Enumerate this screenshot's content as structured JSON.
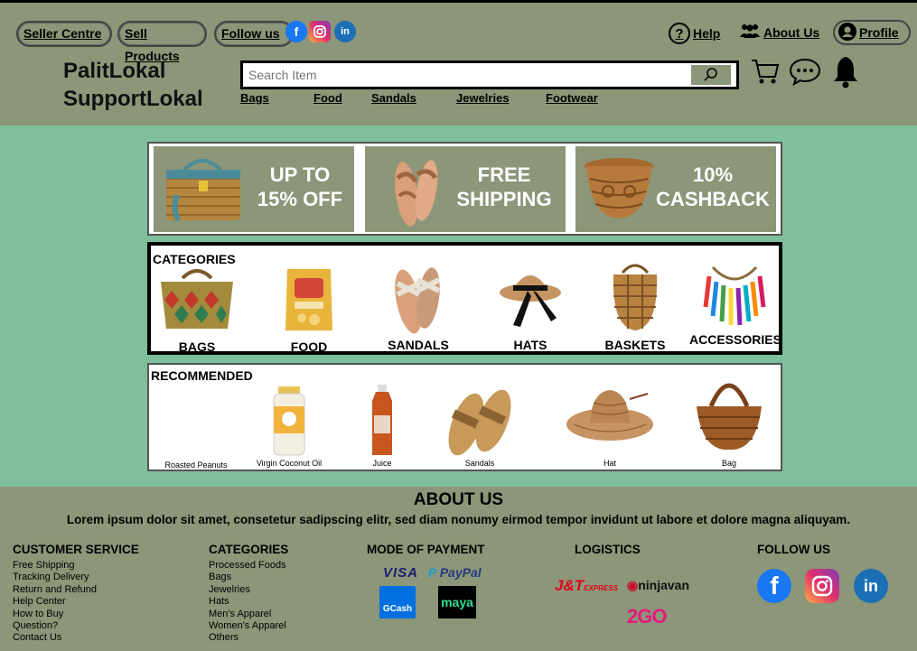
{
  "header": {
    "seller_centre": "Seller Centre",
    "sell_products": "Sell Products",
    "follow_us": "Follow us",
    "help": "Help",
    "about_us": "About Us",
    "profile": "Profile",
    "brand_line1": "PalitLokal",
    "brand_line2": "SupportLokal",
    "search_placeholder": "Search Item",
    "nav": [
      "Bags",
      "Food",
      "Sandals",
      "Jewelries",
      "Footwear"
    ]
  },
  "promos": [
    {
      "line1": "UP TO",
      "line2": "15% OFF"
    },
    {
      "line1": "FREE",
      "line2": "SHIPPING"
    },
    {
      "line1": "10%",
      "line2": "CASHBACK"
    }
  ],
  "categories": {
    "title": "CATEGORIES",
    "items": [
      "BAGS",
      "FOOD",
      "SANDALS",
      "HATS",
      "BASKETS",
      "ACCESSORIES"
    ]
  },
  "recommended": {
    "title": "RECOMMENDED",
    "items": [
      "Roasted Peanuts",
      "Virgin Coconut Oil",
      "Juice",
      "Sandals",
      "Hat",
      "Bag"
    ]
  },
  "about": {
    "title": "ABOUT US",
    "text": "Lorem ipsum dolor sit amet, consetetur sadipscing elitr, sed diam nonumy eirmod tempor invidunt ut labore et dolore magna aliquyam."
  },
  "footer": {
    "customer_service": {
      "title": "CUSTOMER SERVICE",
      "items": [
        "Free Shipping",
        "Tracking Delivery",
        "Return and Refund",
        "Help Center",
        "How to Buy",
        "Question?",
        "Contact Us"
      ]
    },
    "categories": {
      "title": "CATEGORIES",
      "items": [
        "Processed Foods",
        "Bags",
        "Jewelries",
        "Hats",
        "Men's Apparel",
        "Women's Apparel",
        "Others"
      ]
    },
    "payment": {
      "title": "MODE OF PAYMENT",
      "visa": "VISA",
      "paypal": "PayPal",
      "gcash": "GCash",
      "maya": "maya"
    },
    "logistics": {
      "title": "LOGISTICS",
      "jt": "J&T",
      "jt_sub": "EXPRESS",
      "ninjavan": "ninjavan",
      "twogo": "2GO"
    },
    "follow": {
      "title": "FOLLOW US"
    }
  },
  "colors": {
    "header_bg": "#8c9678",
    "page_bg": "#7fbf9c",
    "card_bg": "#ffffff"
  }
}
